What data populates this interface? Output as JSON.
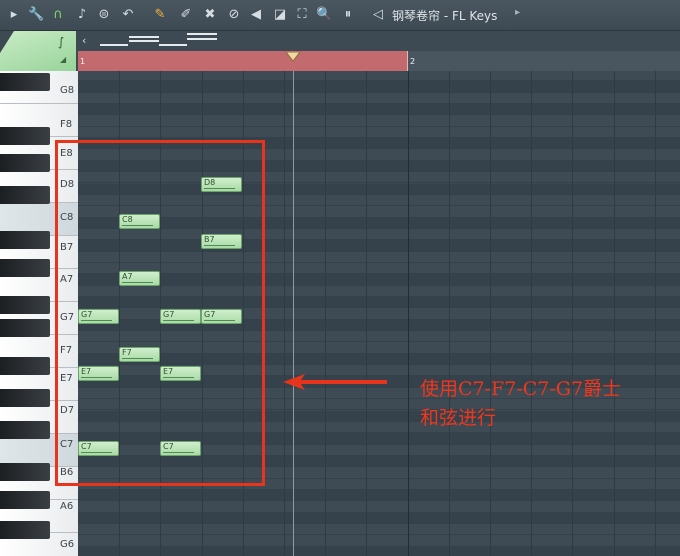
{
  "toolbar": {
    "icons": [
      "play-menu-icon",
      "wrench-icon",
      "magnet-icon",
      "note-icon",
      "menu-circle-icon",
      "undo-icon",
      "pencil-icon",
      "brush-icon",
      "delete-icon",
      "mute-icon",
      "slice-icon",
      "select-icon",
      "zoom-icon",
      "playback-icon",
      "speaker-icon"
    ],
    "title": "钢琴卷帘 - FL Keys",
    "title_arrow": "▸"
  },
  "ruler": {
    "bar1": "1",
    "bar2": "2"
  },
  "keys": [
    "G8",
    "F8",
    "E8",
    "D8",
    "C8",
    "B7",
    "A7",
    "G7",
    "F7",
    "E7",
    "D7",
    "C7",
    "B6",
    "A6",
    "G6"
  ],
  "notes": [
    {
      "label": "D8"
    },
    {
      "label": "C8"
    },
    {
      "label": "B7"
    },
    {
      "label": "A7"
    },
    {
      "label": "G7"
    },
    {
      "label": "G7"
    },
    {
      "label": "G7"
    },
    {
      "label": "F7"
    },
    {
      "label": "E7"
    },
    {
      "label": "E7"
    },
    {
      "label": "C7"
    },
    {
      "label": "C7"
    }
  ],
  "annotation": {
    "line1": "使用C7-F7-C7-G7爵士",
    "line2": "和弦进行"
  },
  "colors": {
    "note": "#b6e2b3",
    "annotation": "#e8341c",
    "loop": "#c36a6e"
  }
}
